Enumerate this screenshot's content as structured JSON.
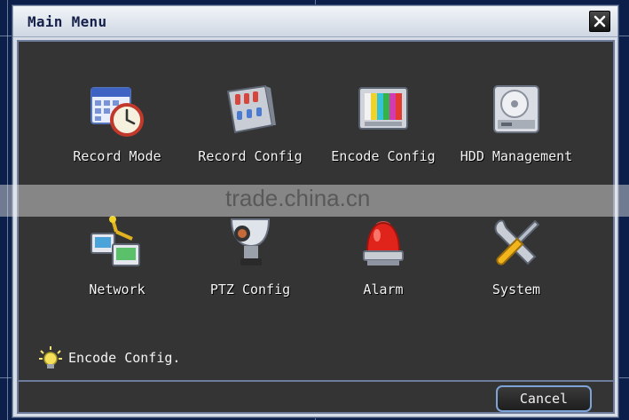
{
  "window": {
    "title": "Main Menu"
  },
  "menu": {
    "items": [
      {
        "label": "Record Mode",
        "icon": "calendar-clock-icon"
      },
      {
        "label": "Record Config",
        "icon": "control-panel-icon"
      },
      {
        "label": "Encode Config",
        "icon": "monitor-color-bars-icon"
      },
      {
        "label": "HDD Management",
        "icon": "hard-drive-icon"
      },
      {
        "label": "Network",
        "icon": "network-computers-icon"
      },
      {
        "label": "PTZ Config",
        "icon": "ptz-camera-icon"
      },
      {
        "label": "Alarm",
        "icon": "alarm-siren-icon"
      },
      {
        "label": "System",
        "icon": "tools-icon"
      }
    ]
  },
  "status": {
    "text": "Encode Config.",
    "icon": "lightbulb-icon"
  },
  "footer": {
    "cancel_label": "Cancel"
  },
  "watermark": "trade.china.cn",
  "colors": {
    "panel": "#343434",
    "border": "#6c7c9a",
    "titlebar": "#dfe5ee",
    "button_border": "#7ea3d6"
  }
}
